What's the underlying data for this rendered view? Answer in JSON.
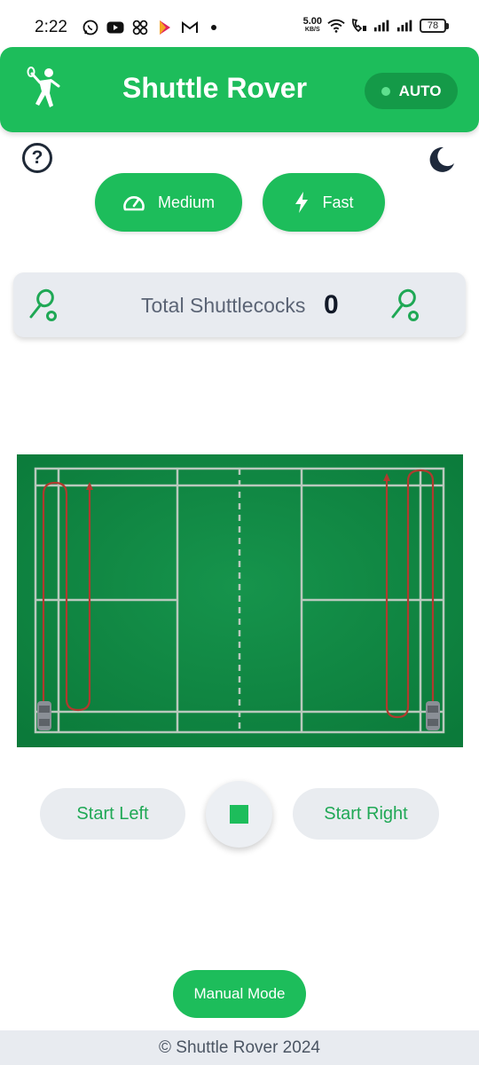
{
  "status_bar": {
    "time": "2:22",
    "net_speed": "5.00",
    "net_speed_unit": "KB/S",
    "battery": "78",
    "left_icons": [
      "whatsapp-icon",
      "youtube-icon",
      "apps-icon",
      "play-icon",
      "gmail-icon"
    ]
  },
  "header": {
    "title": "Shuttle Rover",
    "mode_badge": "AUTO",
    "brand_color": "#1dbd5b"
  },
  "speed_controls": {
    "medium_label": "Medium",
    "fast_label": "Fast"
  },
  "counter": {
    "label": "Total Shuttlecocks",
    "value": "0"
  },
  "controls": {
    "start_left": "Start Left",
    "start_right": "Start Right"
  },
  "manual_mode_label": "Manual Mode",
  "footer": {
    "text": "© Shuttle Rover 2024"
  }
}
